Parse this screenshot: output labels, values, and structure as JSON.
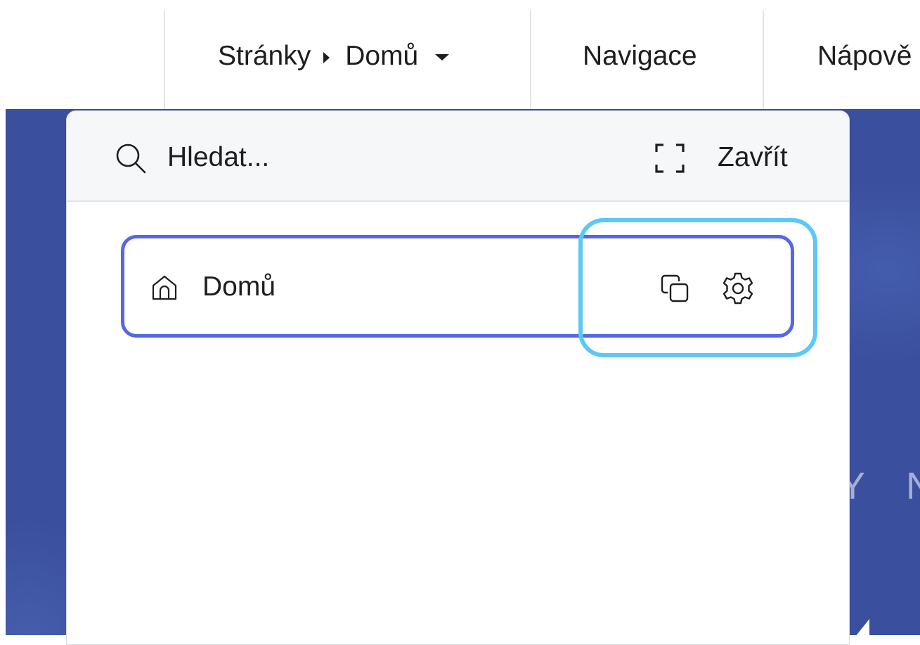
{
  "toolbar": {
    "breadcrumb_root": "Stránky",
    "breadcrumb_current": "Domů",
    "navigation_label": "Navigace",
    "help_label": "Nápově"
  },
  "canvas": {
    "background_text": "Y N"
  },
  "panel": {
    "search_placeholder": "Hledat...",
    "close_label": "Zavřít",
    "pages": [
      {
        "label": "Domů",
        "icon": "home-icon",
        "actions": [
          "duplicate-icon",
          "settings-icon"
        ]
      }
    ]
  },
  "colors": {
    "canvas_background": "#3a4f9e",
    "row_border": "#5567e8",
    "highlight_border": "#5bc8f5",
    "text": "#1e1e1e"
  }
}
